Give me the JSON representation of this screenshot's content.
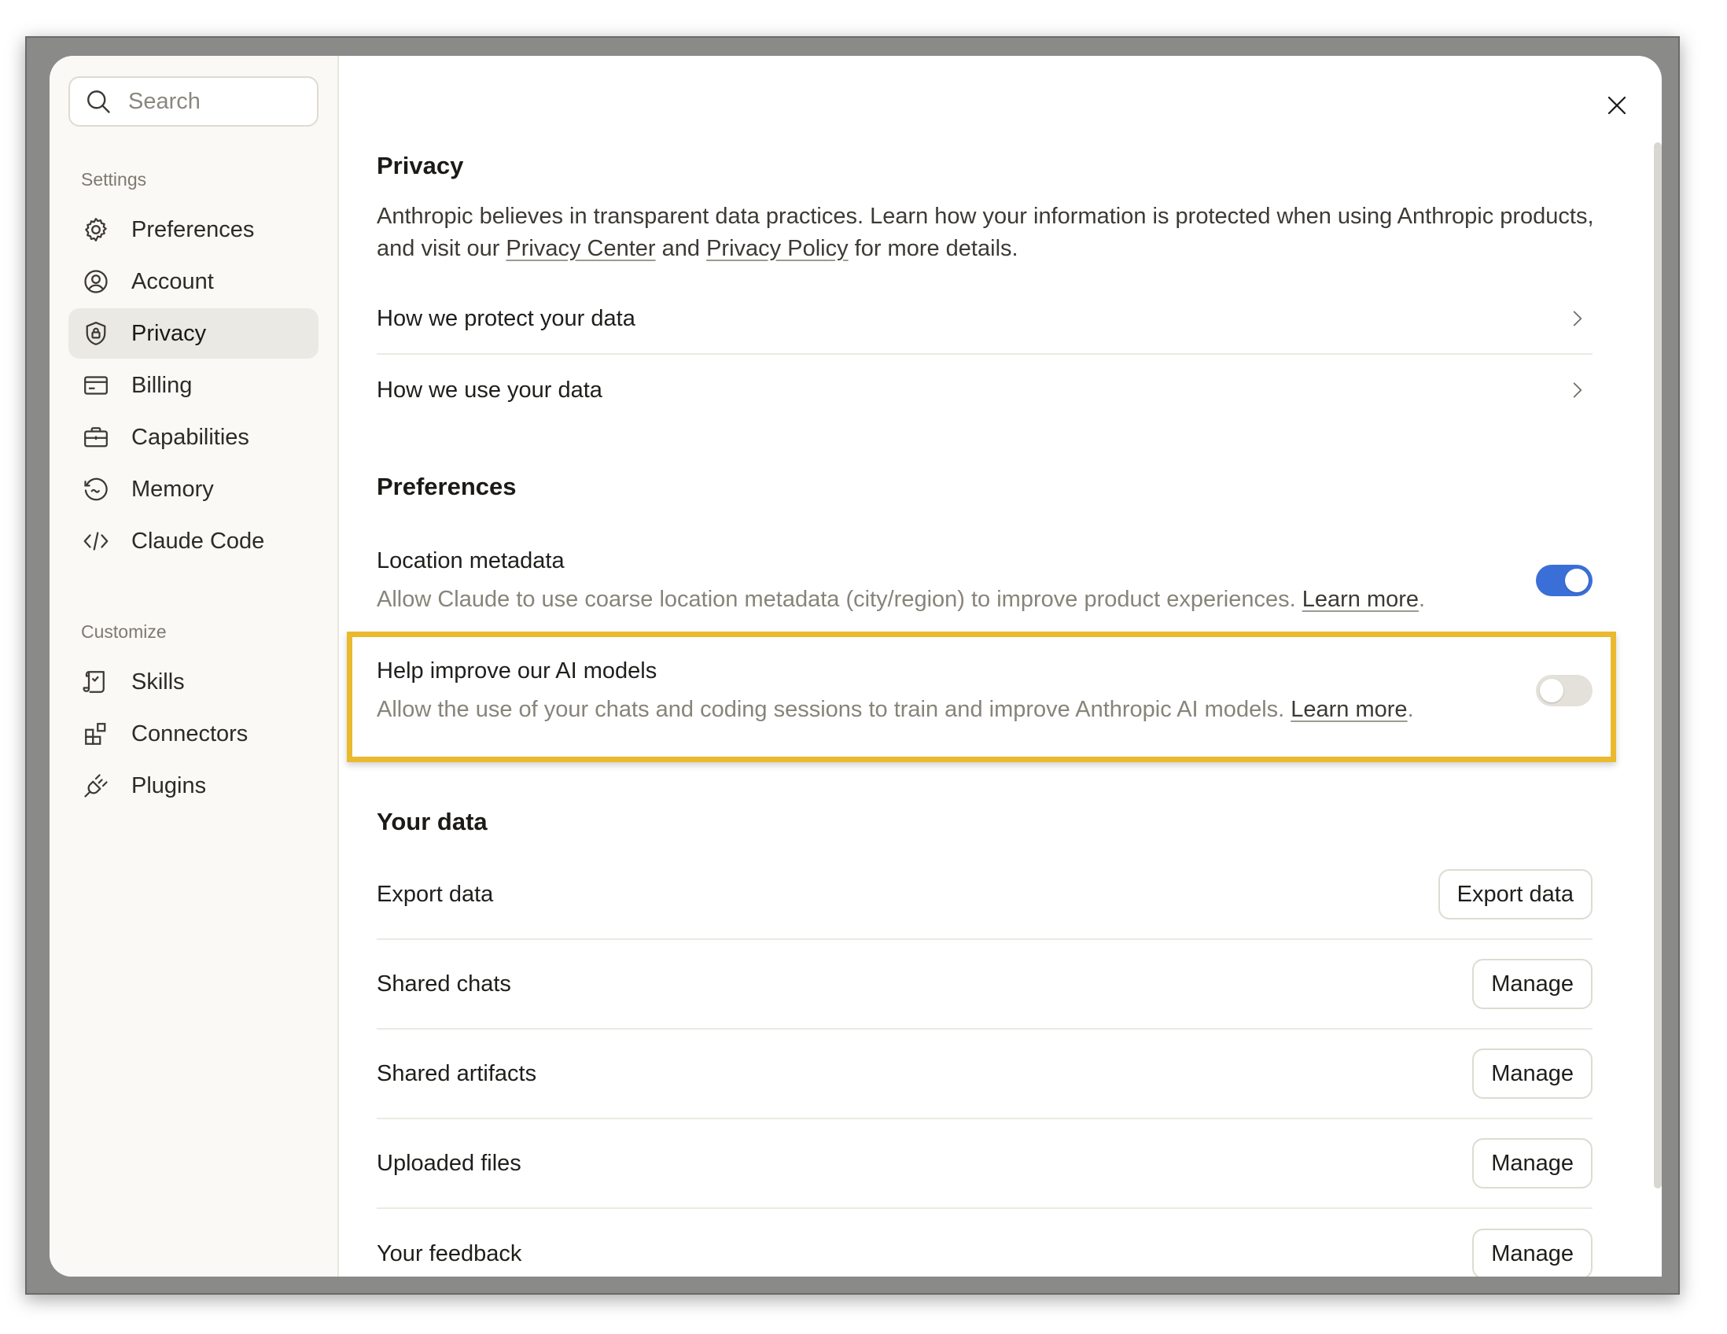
{
  "search": {
    "placeholder": "Search"
  },
  "sidebar": {
    "settings_label": "Settings",
    "settings_items": [
      {
        "label": "Preferences",
        "icon": "gear-icon"
      },
      {
        "label": "Account",
        "icon": "user-circle-icon"
      },
      {
        "label": "Privacy",
        "icon": "shield-lock-icon",
        "active": true
      },
      {
        "label": "Billing",
        "icon": "credit-card-icon"
      },
      {
        "label": "Capabilities",
        "icon": "briefcase-icon"
      },
      {
        "label": "Memory",
        "icon": "memory-icon"
      },
      {
        "label": "Claude Code",
        "icon": "code-icon"
      }
    ],
    "customize_label": "Customize",
    "customize_items": [
      {
        "label": "Skills",
        "icon": "scroll-icon"
      },
      {
        "label": "Connectors",
        "icon": "blocks-icon"
      },
      {
        "label": "Plugins",
        "icon": "plug-icon"
      }
    ]
  },
  "privacy": {
    "title": "Privacy",
    "intro_part1": "Anthropic believes in transparent data practices. Learn how your information is protected when using Anthropic products, and visit our ",
    "privacy_center": "Privacy Center",
    "intro_and": " and ",
    "privacy_policy": "Privacy Policy",
    "intro_part2": " for more details.",
    "links": [
      "How we protect your data",
      "How we use your data"
    ]
  },
  "preferences": {
    "title": "Preferences",
    "location": {
      "title": "Location metadata",
      "description": "Allow Claude to use coarse location metadata (city/region) to improve product experiences. ",
      "learn_more": "Learn more",
      "enabled": true
    },
    "improve_models": {
      "title": "Help improve our AI models",
      "description": "Allow the use of your chats and coding sessions to train and improve Anthropic AI models. ",
      "learn_more": "Learn more",
      "enabled": false
    },
    "period": "."
  },
  "your_data": {
    "title": "Your data",
    "rows": [
      {
        "label": "Export data",
        "button": "Export data"
      },
      {
        "label": "Shared chats",
        "button": "Manage"
      },
      {
        "label": "Shared artifacts",
        "button": "Manage"
      },
      {
        "label": "Uploaded files",
        "button": "Manage"
      },
      {
        "label": "Your feedback",
        "button": "Manage"
      }
    ]
  },
  "colors": {
    "accent_toggle": "#3b6fd8",
    "highlight_border": "#eab92e",
    "sidebar_bg": "#faf9f5"
  }
}
